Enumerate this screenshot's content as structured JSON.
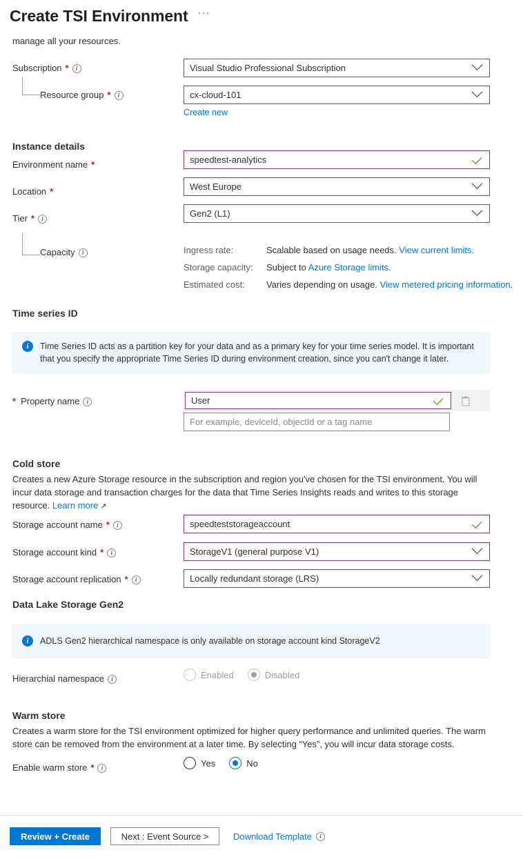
{
  "header": {
    "title": "Create TSI Environment",
    "more_menu": "···"
  },
  "intro": {
    "clipped_text": "manage all your resources."
  },
  "basics": {
    "subscription": {
      "label": "Subscription",
      "required_mark": "*",
      "value": "Visual Studio Professional Subscription"
    },
    "resource_group": {
      "label": "Resource group",
      "required_mark": "*",
      "value": "cx-cloud-101",
      "create_new_link": "Create new"
    }
  },
  "instance_details": {
    "heading": "Instance details",
    "environment_name": {
      "label": "Environment name",
      "required_mark": "*",
      "value": "speedtest-analytics"
    },
    "location": {
      "label": "Location",
      "required_mark": "*",
      "value": "West Europe"
    },
    "tier": {
      "label": "Tier",
      "required_mark": "*",
      "value": "Gen2 (L1)"
    },
    "capacity": {
      "label": "Capacity",
      "rows": [
        {
          "key": "Ingress rate:",
          "text": "Scalable based on usage needs.",
          "link": "View current limits",
          "suffix": "."
        },
        {
          "key": "Storage capacity:",
          "text": "Subject to",
          "link": "Azure Storage limits",
          "suffix": "."
        },
        {
          "key": "Estimated cost:",
          "text": "Varies depending on usage.",
          "link": "View metered pricing information",
          "suffix": "."
        }
      ]
    }
  },
  "time_series_id": {
    "heading": "Time series ID",
    "banner": "Time Series ID acts as a partition key for your data and as a primary key for your time series model. It is important that you specify the appropriate Time Series ID during environment creation, since you can't change it later.",
    "property_name": {
      "label": "Property name",
      "required_mark": "*",
      "value": "User",
      "placeholder": "For example, deviceId, objectId or a tag name"
    }
  },
  "cold_store": {
    "heading": "Cold store",
    "description": "Creates a new Azure Storage resource in the subscription and region you've chosen for the TSI environment. You will incur data storage and transaction charges for the data that Time Series Insights reads and writes to this storage resource.",
    "learn_more": "Learn more",
    "storage_account_name": {
      "label": "Storage account name",
      "required_mark": "*",
      "value": "speedteststorageaccount"
    },
    "storage_account_kind": {
      "label": "Storage account kind",
      "required_mark": "*",
      "value": "StorageV1 (general purpose V1)"
    },
    "storage_account_replication": {
      "label": "Storage account replication",
      "required_mark": "*",
      "value": "Locally redundant storage (LRS)"
    }
  },
  "data_lake": {
    "heading": "Data Lake Storage Gen2",
    "banner": "ADLS Gen2 hierarchical namespace is only available on storage account kind StorageV2",
    "hierarchial_namespace": {
      "label": "Hierarchial namespace",
      "options": [
        "Enabled",
        "Disabled"
      ],
      "selected": "Disabled",
      "disabled": true
    }
  },
  "warm_store": {
    "heading": "Warm store",
    "description": "Creates a warm store for the TSI environment optimized for higher query performance and unlimited queries. The warm store can be removed from the environment at a later time. By selecting “Yes”, you will incur data storage costs.",
    "enable_warm_store": {
      "label": "Enable warm store",
      "required_mark": "*",
      "options": [
        "Yes",
        "No"
      ],
      "selected": "No"
    }
  },
  "footer": {
    "review_create": "Review + Create",
    "next": "Next : Event Source >",
    "download_template": "Download Template"
  },
  "colors": {
    "accent": "#0078d4",
    "banner_bg": "#eff6fc",
    "valid_border": "#8c2d8c",
    "check_green": "#498205",
    "required_red": "#a4262c"
  }
}
